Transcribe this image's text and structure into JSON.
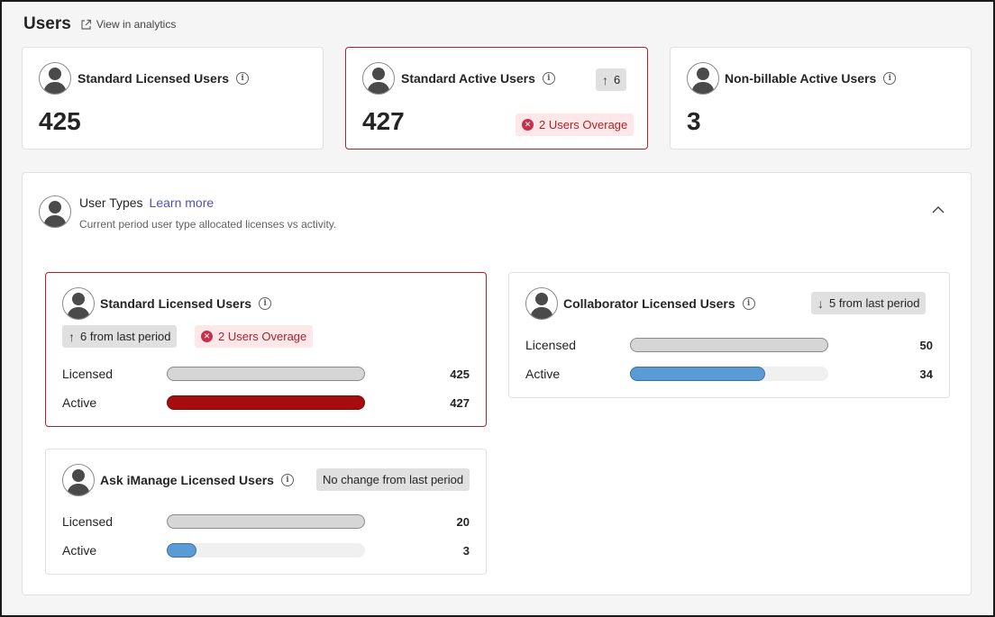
{
  "header": {
    "title": "Users",
    "analytics_link": "View in analytics"
  },
  "summary": [
    {
      "title": "Standard Licensed Users",
      "value": "425"
    },
    {
      "title": "Standard Active Users",
      "value": "427",
      "change": "6",
      "overage": "2 Users Overage"
    },
    {
      "title": "Non-billable Active Users",
      "value": "3"
    }
  ],
  "user_types": {
    "title": "User Types",
    "learn_more": "Learn more",
    "subtitle": "Current period user type allocated licenses vs activity.",
    "cards": [
      {
        "title": "Standard Licensed Users",
        "change": "6 from last period",
        "overage": "2 Users Overage",
        "rows": [
          {
            "label": "Licensed",
            "value": "425",
            "fraction": 1.0,
            "color": "#d6d6d6"
          },
          {
            "label": "Active",
            "value": "427",
            "fraction": 1.0,
            "color": "#a80d0d"
          }
        ]
      },
      {
        "title": "Collaborator Licensed Users",
        "change": "5 from last period",
        "rows": [
          {
            "label": "Licensed",
            "value": "50",
            "fraction": 1.0,
            "color": "#d6d6d6"
          },
          {
            "label": "Active",
            "value": "34",
            "fraction": 0.68,
            "color": "#5b9bd5"
          }
        ]
      },
      {
        "title": "Ask iManage Licensed Users",
        "change": "No change from last period",
        "rows": [
          {
            "label": "Licensed",
            "value": "20",
            "fraction": 1.0,
            "color": "#d6d6d6"
          },
          {
            "label": "Active",
            "value": "3",
            "fraction": 0.15,
            "color": "#5b9bd5"
          }
        ]
      }
    ]
  },
  "colors": {
    "accent_red": "#a4262c",
    "link": "#4f52b2",
    "bar_blue": "#5b9bd5",
    "bar_grey": "#d6d6d6",
    "bar_red": "#a80d0d"
  }
}
